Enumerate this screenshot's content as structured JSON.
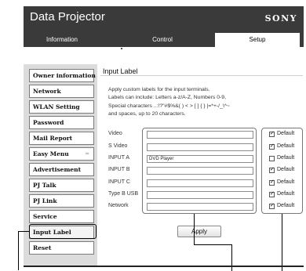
{
  "header": {
    "app_title": "Data Projector",
    "brand": "SONY",
    "tabs": [
      {
        "label": "Information",
        "active": false
      },
      {
        "label": "Control",
        "active": false
      },
      {
        "label": "Setup",
        "active": true
      }
    ]
  },
  "sidebar": {
    "items": [
      {
        "label": "Owner information"
      },
      {
        "label": "Network"
      },
      {
        "label": "WLAN Setting"
      },
      {
        "label": "Password"
      },
      {
        "label": "Mail Report"
      },
      {
        "label": "Easy Menu",
        "expand_icon": "≈"
      },
      {
        "label": "Advertisement"
      },
      {
        "label": "PJ Talk"
      },
      {
        "label": "PJ Link"
      },
      {
        "label": "Service"
      },
      {
        "label": "Input Label",
        "selected": true
      },
      {
        "label": "Reset"
      }
    ]
  },
  "main": {
    "title": "Input Label",
    "description": [
      "Apply custom labels for the input terminals.",
      "Labels can include: Letters a-z/A-Z, Numbers 0-9,",
      "Special characters ..:!?\"#$%&( ) < > [ ] { } |=*+-/_\\^~",
      "and spaces, up to 20 characters."
    ],
    "inputs": [
      {
        "name": "Video",
        "value": "",
        "default_label": "Default",
        "default_checked": true
      },
      {
        "name": "S Video",
        "value": "",
        "default_label": "Default",
        "default_checked": true
      },
      {
        "name": "INPUT A",
        "value": "DVD Player",
        "default_label": "Default",
        "default_checked": false
      },
      {
        "name": "INPUT B",
        "value": "",
        "default_label": "Default",
        "default_checked": true
      },
      {
        "name": "INPUT C",
        "value": "",
        "default_label": "Default",
        "default_checked": true
      },
      {
        "name": "Type B USB",
        "value": "",
        "default_label": "Default",
        "default_checked": true
      },
      {
        "name": "Network",
        "value": "",
        "default_label": "Default",
        "default_checked": true
      }
    ],
    "apply_label": "Apply"
  },
  "icons": {
    "checkmark": "✓"
  },
  "colors": {
    "header_bg": "#3a3a3a",
    "sidebar_bg": "#dcdcdc"
  }
}
